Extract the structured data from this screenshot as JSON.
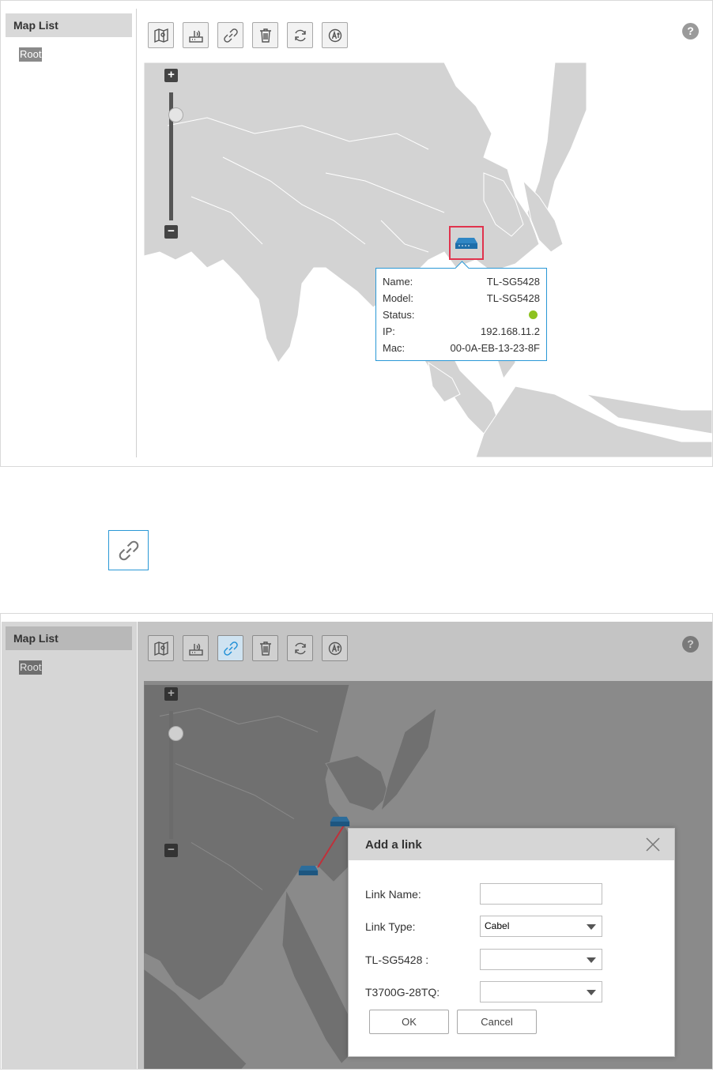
{
  "sidebar": {
    "header": "Map List",
    "items": [
      {
        "label": "Root"
      }
    ]
  },
  "toolbar": {
    "buttons": [
      {
        "icon": "map-icon"
      },
      {
        "icon": "router-icon"
      },
      {
        "icon": "link-icon"
      },
      {
        "icon": "trash-icon"
      },
      {
        "icon": "refresh-icon"
      },
      {
        "icon": "auto-layout-icon"
      }
    ],
    "help_label": "?"
  },
  "zoom": {
    "plus": "+",
    "minus": "−"
  },
  "tooltip": {
    "rows": [
      {
        "label": "Name:",
        "value": "TL-SG5428"
      },
      {
        "label": "Model:",
        "value": "TL-SG5428"
      },
      {
        "label": "Status:",
        "value": ""
      },
      {
        "label": "IP:",
        "value": "192.168.11.2"
      },
      {
        "label": "Mac:",
        "value": "00-0A-EB-13-23-8F"
      }
    ],
    "status_color": "#8dc21f"
  },
  "dialog": {
    "title": "Add a link",
    "fields": [
      {
        "label": "Link Name:",
        "value": ""
      },
      {
        "label": "Link Type:",
        "value": "Cabel"
      },
      {
        "label": "TL-SG5428 :",
        "value": ""
      },
      {
        "label": "T3700G-28TQ:",
        "value": ""
      }
    ],
    "ok": "OK",
    "cancel": "Cancel"
  },
  "colors": {
    "accent": "#1b8dd6",
    "highlight": "#e0334d",
    "link": "#c0303a"
  }
}
